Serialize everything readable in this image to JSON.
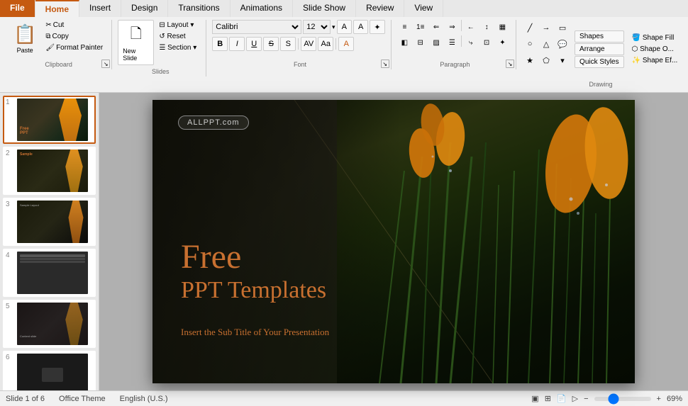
{
  "tabs": {
    "file": "File",
    "home": "Home",
    "insert": "Insert",
    "design": "Design",
    "transitions": "Transitions",
    "animations": "Animations",
    "slideshow": "Slide Show",
    "review": "Review",
    "view": "View"
  },
  "clipboard": {
    "paste_label": "Paste",
    "cut_label": "Cut",
    "copy_label": "Copy",
    "format_painter_label": "Format Painter",
    "group_label": "Clipboard"
  },
  "slides": {
    "new_slide_label": "New\nSlide",
    "layout_label": "Layout",
    "reset_label": "Reset",
    "section_label": "Section",
    "group_label": "Slides"
  },
  "font": {
    "font_name": "Calibri",
    "font_size": "12",
    "grow_label": "A",
    "shrink_label": "A",
    "clear_label": "A",
    "bold_label": "B",
    "italic_label": "I",
    "underline_label": "U",
    "strike_label": "S",
    "shadow_label": "S",
    "char_space_label": "A",
    "case_label": "Aa",
    "font_color_label": "A",
    "group_label": "Font"
  },
  "paragraph": {
    "bullets_label": "≡",
    "numbering_label": "≡",
    "dec_indent_label": "⇐",
    "inc_indent_label": "⇒",
    "rtl_label": "←",
    "line_spacing_label": "↕",
    "align_left_label": "≡",
    "align_center_label": "≡",
    "align_right_label": "≡",
    "justify_label": "≡",
    "columns_label": "▦",
    "direction_label": "⤷",
    "align_label": "⊡",
    "smartart_label": "✦",
    "group_label": "Paragraph"
  },
  "drawing": {
    "shapes_label": "Shapes",
    "arrange_label": "Arrange",
    "quick_styles_label": "Quick\nStyles",
    "shape_fill_label": "Shape Fill",
    "shape_outline_label": "Shape O...",
    "shape_effects_label": "Shape Ef...",
    "group_label": "Drawing"
  },
  "slide": {
    "badge": "ALLPPT.com",
    "title_line1": "Free",
    "title_line2": "PPT Templates",
    "subtitle": "Insert the Sub Title of Your Presentation"
  },
  "status": {
    "slide_info": "Slide 1 of 6",
    "theme": "Office Theme",
    "language": "English (U.S.)",
    "zoom": "69%",
    "view_normal": "▣",
    "view_slide_sorter": "⊞",
    "view_reading": "📄",
    "view_slideshow": "▷"
  },
  "slides_panel": [
    {
      "num": "1"
    },
    {
      "num": "2"
    },
    {
      "num": "3"
    },
    {
      "num": "4"
    },
    {
      "num": "5"
    },
    {
      "num": "6"
    }
  ]
}
